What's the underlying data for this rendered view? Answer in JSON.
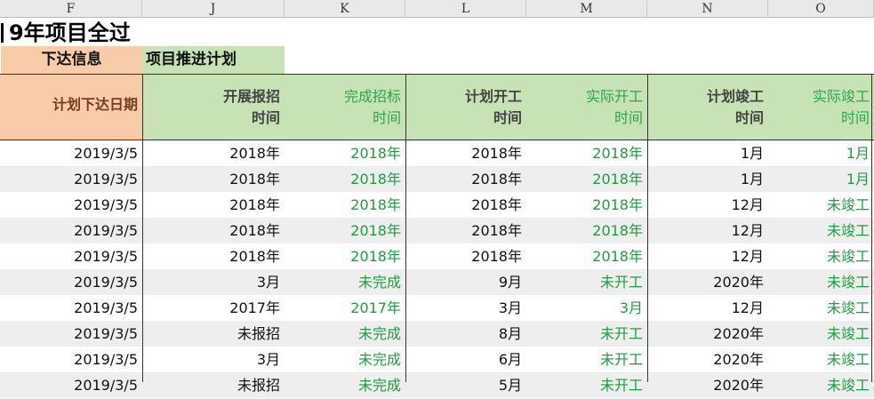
{
  "column_letters": [
    "F",
    "J",
    "K",
    "L",
    "M",
    "N",
    "O"
  ],
  "title": "9年项目全过",
  "band_labels": {
    "orange": "下达信息",
    "green": "项目推进计划"
  },
  "headers": [
    {
      "line1": "计划下达日期",
      "line2": ""
    },
    {
      "line1": "开展报招",
      "line2": "时间"
    },
    {
      "line1": "完成招标",
      "line2": "时间"
    },
    {
      "line1": "计划开工",
      "line2": "时间"
    },
    {
      "line1": "实际开工",
      "line2": "时间"
    },
    {
      "line1": "计划竣工",
      "line2": "时间"
    },
    {
      "line1": "实际竣工",
      "line2": "时间"
    }
  ],
  "rows": [
    [
      "2019/3/5",
      "2018年",
      "2018年",
      "2018年",
      "2018年",
      "1月",
      "1月"
    ],
    [
      "2019/3/5",
      "2018年",
      "2018年",
      "2018年",
      "2018年",
      "1月",
      "1月"
    ],
    [
      "2019/3/5",
      "2018年",
      "2018年",
      "2018年",
      "2018年",
      "12月",
      "未竣工"
    ],
    [
      "2019/3/5",
      "2018年",
      "2018年",
      "2018年",
      "2018年",
      "12月",
      "未竣工"
    ],
    [
      "2019/3/5",
      "2018年",
      "2018年",
      "2018年",
      "2018年",
      "12月",
      "未竣工"
    ],
    [
      "2019/3/5",
      "3月",
      "未完成",
      "9月",
      "未开工",
      "2020年",
      "未竣工"
    ],
    [
      "2019/3/5",
      "2017年",
      "2017年",
      "3月",
      "3月",
      "12月",
      "未竣工"
    ],
    [
      "2019/3/5",
      "未报招",
      "未完成",
      "8月",
      "未开工",
      "2020年",
      "未竣工"
    ],
    [
      "2019/3/5",
      "3月",
      "未完成",
      "6月",
      "未开工",
      "2020年",
      "未竣工"
    ],
    [
      "2019/3/5",
      "未报招",
      "未完成",
      "5月",
      "未开工",
      "2020年",
      "未竣工"
    ]
  ],
  "colors": {
    "orange_fill": "#f8cba9",
    "green_fill": "#c7e2b4",
    "actual_text": "#1c9e43"
  }
}
